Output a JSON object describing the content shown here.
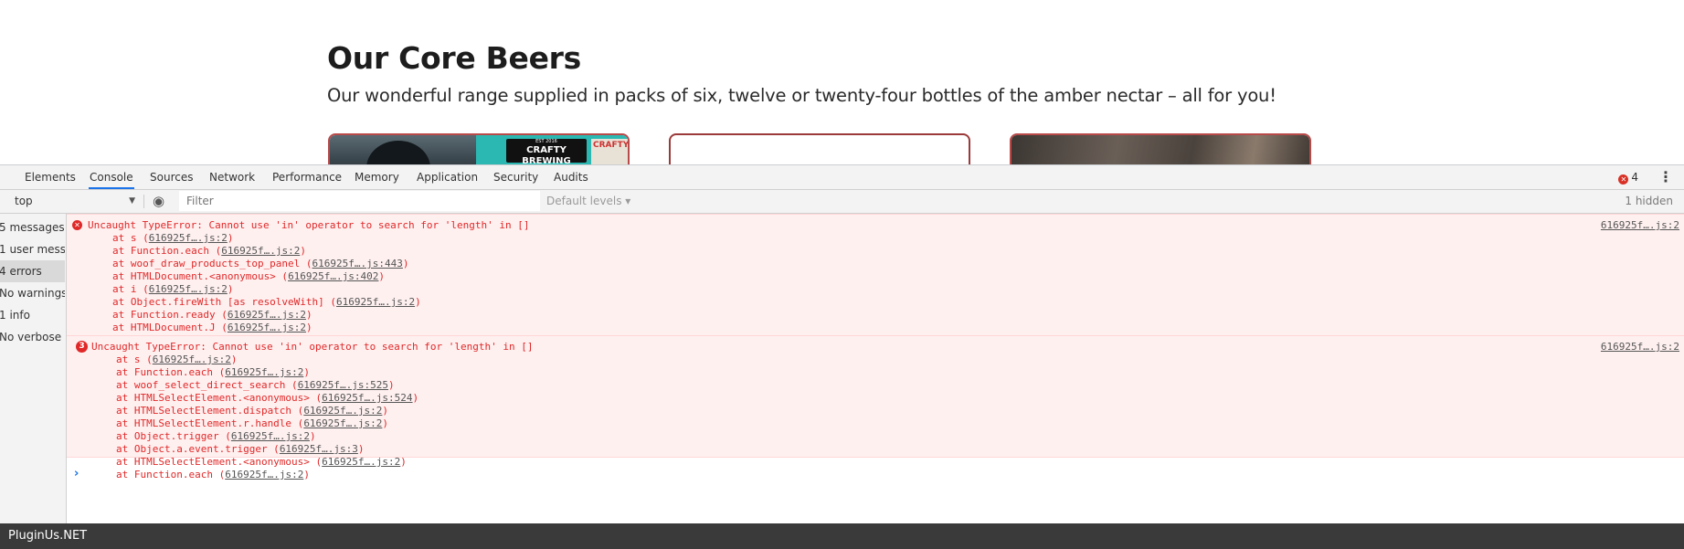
{
  "page": {
    "title": "Our Core Beers",
    "subtitle": "Our wonderful range supplied in packs of six, twelve or twenty-four bottles of the amber nectar – all for you!",
    "card1_label_top": "EST 2016",
    "card1_label_main": "CRAFTY BREWING",
    "card1_label2": "CRAFTY"
  },
  "devtools": {
    "tabs": [
      "Elements",
      "Console",
      "Sources",
      "Network",
      "Performance",
      "Memory",
      "Application",
      "Security",
      "Audits"
    ],
    "active_tab": "Console",
    "error_count": "4",
    "toolbar": {
      "context": "top",
      "filter_placeholder": "Filter",
      "levels": "Default levels ▾",
      "hidden": "1 hidden"
    },
    "sidebar": [
      {
        "label": "5 messages"
      },
      {
        "label": "1 user messages"
      },
      {
        "label": "4 errors",
        "selected": true
      },
      {
        "label": "No warnings"
      },
      {
        "label": "1 info"
      },
      {
        "label": "No verbose"
      }
    ],
    "messages": [
      {
        "icon": "error-icon",
        "badge": "",
        "text": "Uncaught TypeError: Cannot use 'in' operator to search for 'length' in []",
        "source": "616925f….js:2",
        "stack": [
          {
            "fn": "at s (",
            "ref": "616925f….js:2",
            "end": ")"
          },
          {
            "fn": "at Function.each (",
            "ref": "616925f….js:2",
            "end": ")"
          },
          {
            "fn": "at woof_draw_products_top_panel (",
            "ref": "616925f….js:443",
            "end": ")"
          },
          {
            "fn": "at HTMLDocument.<anonymous> (",
            "ref": "616925f….js:402",
            "end": ")"
          },
          {
            "fn": "at i (",
            "ref": "616925f….js:2",
            "end": ")"
          },
          {
            "fn": "at Object.fireWith [as resolveWith] (",
            "ref": "616925f….js:2",
            "end": ")"
          },
          {
            "fn": "at Function.ready (",
            "ref": "616925f….js:2",
            "end": ")"
          },
          {
            "fn": "at HTMLDocument.J (",
            "ref": "616925f….js:2",
            "end": ")"
          }
        ]
      },
      {
        "icon": "error-count-icon",
        "badge": "3",
        "text": "Uncaught TypeError: Cannot use 'in' operator to search for 'length' in []",
        "source": "616925f….js:2",
        "stack": [
          {
            "fn": "at s (",
            "ref": "616925f….js:2",
            "end": ")"
          },
          {
            "fn": "at Function.each (",
            "ref": "616925f….js:2",
            "end": ")"
          },
          {
            "fn": "at woof_select_direct_search (",
            "ref": "616925f….js:525",
            "end": ")"
          },
          {
            "fn": "at HTMLSelectElement.<anonymous> (",
            "ref": "616925f….js:524",
            "end": ")"
          },
          {
            "fn": "at HTMLSelectElement.dispatch (",
            "ref": "616925f….js:2",
            "end": ")"
          },
          {
            "fn": "at HTMLSelectElement.r.handle (",
            "ref": "616925f….js:2",
            "end": ")"
          },
          {
            "fn": "at Object.trigger (",
            "ref": "616925f….js:2",
            "end": ")"
          },
          {
            "fn": "at Object.a.event.trigger (",
            "ref": "616925f….js:3",
            "end": ")"
          },
          {
            "fn": "at HTMLSelectElement.<anonymous> (",
            "ref": "616925f….js:2",
            "end": ")"
          },
          {
            "fn": "at Function.each (",
            "ref": "616925f….js:2",
            "end": ")"
          }
        ]
      }
    ],
    "prompt": "›"
  },
  "footer": {
    "text": "PluginUs.NET"
  },
  "colors": {
    "error": "#e02828",
    "error_bg": "#fff0f0",
    "accent": "#1a73e8",
    "footer_bg": "#3a3a3a"
  }
}
